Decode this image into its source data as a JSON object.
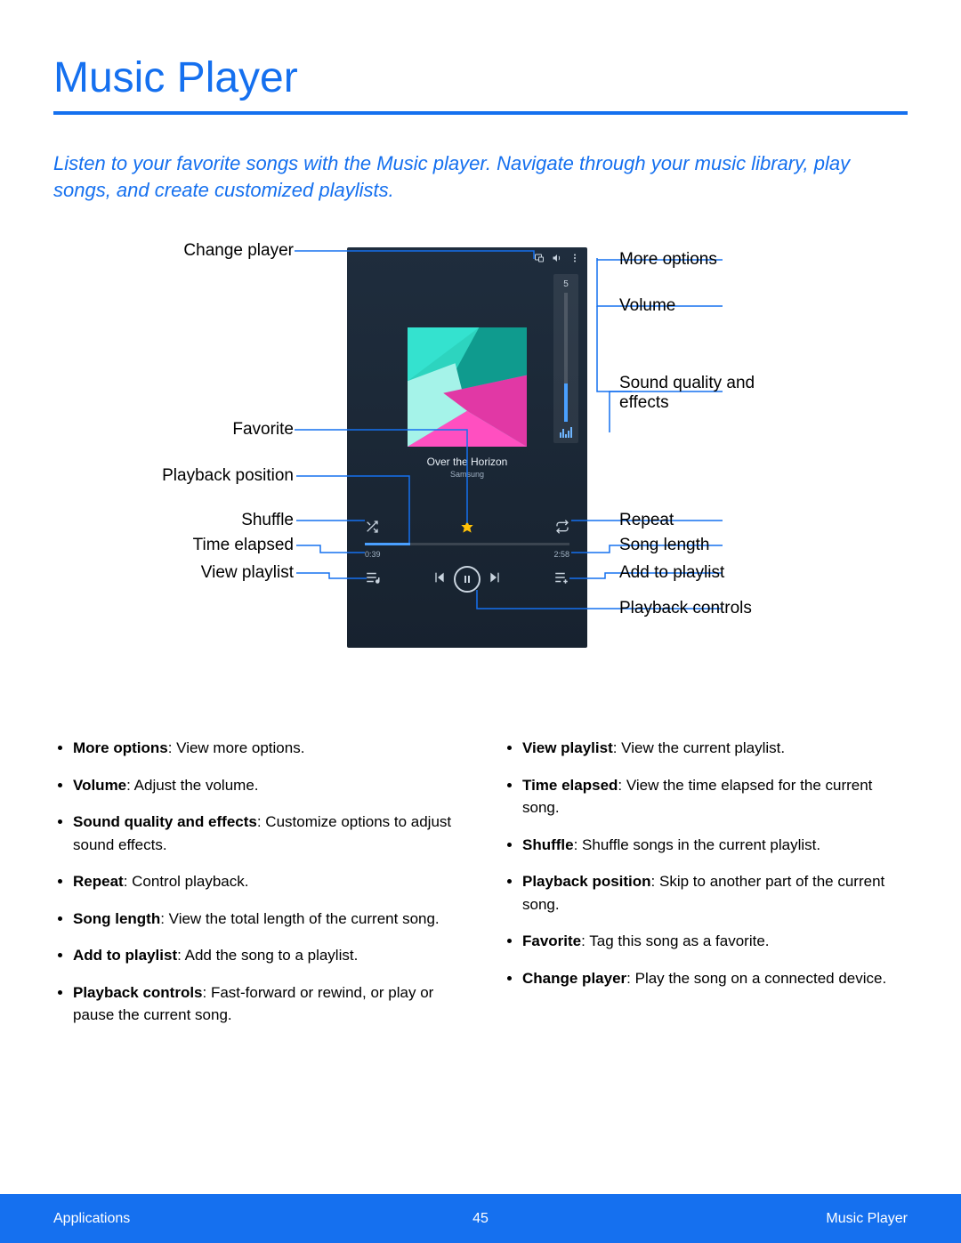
{
  "title": "Music Player",
  "intro": "Listen to your favorite songs with the Music player. Navigate through your music library, play songs, and create customized playlists.",
  "labels": {
    "change_player": "Change player",
    "favorite": "Favorite",
    "playback_position": "Playback position",
    "shuffle": "Shuffle",
    "time_elapsed": "Time elapsed",
    "view_playlist": "View playlist",
    "more_options": "More options",
    "volume": "Volume",
    "sound_quality": "Sound quality and effects",
    "repeat": "Repeat",
    "song_length": "Song length",
    "add_to_playlist": "Add to playlist",
    "playback_controls": "Playback controls"
  },
  "phone": {
    "volume_value": "5",
    "song_title": "Over the Horizon",
    "song_artist": "Samsung",
    "time_elapsed": "0:39",
    "time_total": "2:58"
  },
  "definitions_left": [
    {
      "term": "More options",
      "desc": ": View more options."
    },
    {
      "term": "Volume",
      "desc": ": Adjust the volume."
    },
    {
      "term": "Sound quality and effects",
      "desc": ": Customize options to adjust sound effects."
    },
    {
      "term": "Repeat",
      "desc": ": Control playback."
    },
    {
      "term": "Song length",
      "desc": ": View the total length of the current song."
    },
    {
      "term": "Add to playlist",
      "desc": ": Add the song to a playlist."
    },
    {
      "term": "Playback controls",
      "desc": ": Fast-forward or rewind, or play or pause the current song."
    }
  ],
  "definitions_right": [
    {
      "term": "View playlist",
      "desc": ": View the current playlist."
    },
    {
      "term": "Time elapsed",
      "desc": ": View the time elapsed for the current song."
    },
    {
      "term": "Shuffle",
      "desc": ": Shuffle songs in the current playlist."
    },
    {
      "term": "Playback position",
      "desc": ": Skip to another part of the current song."
    },
    {
      "term": "Favorite",
      "desc": ": Tag this song as a favorite."
    },
    {
      "term": "Change player",
      "desc": ": Play the song on a connected device."
    }
  ],
  "footer": {
    "left": "Applications",
    "center": "45",
    "right": "Music Player"
  }
}
